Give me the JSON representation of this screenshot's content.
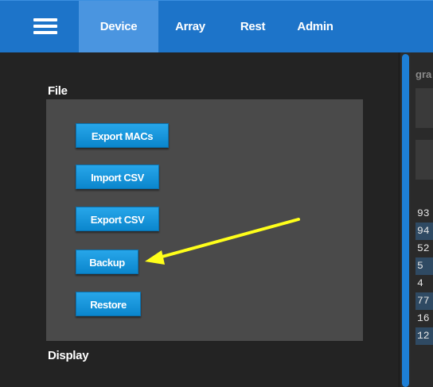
{
  "nav": {
    "menu_icon": "hamburger-menu-icon",
    "tabs": [
      {
        "label": "Device",
        "active": true
      },
      {
        "label": "Array",
        "active": false
      },
      {
        "label": "Rest",
        "active": false
      },
      {
        "label": "Admin",
        "active": false
      }
    ]
  },
  "file_section": {
    "title": "File",
    "buttons": {
      "export_macs": "Export MACs",
      "import_csv": "Import CSV",
      "export_csv": "Export CSV",
      "backup": "Backup",
      "restore": "Restore"
    }
  },
  "display_section": {
    "title": "Display"
  },
  "right_panel": {
    "header_fragment": "gra",
    "rows": [
      "93",
      "94",
      "52",
      "5",
      "4",
      "77",
      "16",
      "12"
    ]
  },
  "annotation": {
    "arrow_color": "#ffff1a",
    "points_to": "Backup"
  },
  "colors": {
    "topbar": "#1d74c9",
    "active_tab": "#4a95e0",
    "button": "#1496dd",
    "panel_bg": "#232323",
    "file_box": "#4a4a4a"
  }
}
